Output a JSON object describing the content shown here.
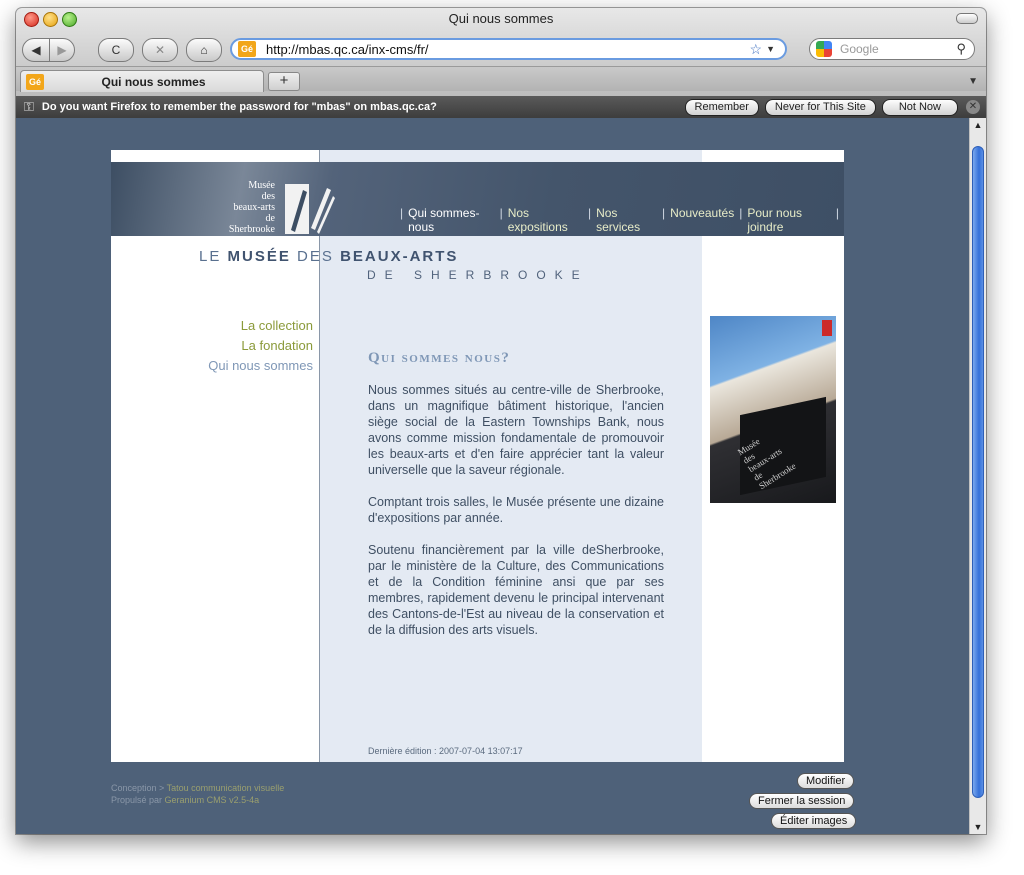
{
  "browser": {
    "window_title": "Qui nous sommes",
    "url": "http://mbas.qc.ca/inx-cms/fr/",
    "search_placeholder": "Google",
    "tab_title": "Qui nous sommes",
    "favicon_text": "Gé",
    "new_tab_label": "+",
    "nav_buttons": {
      "back": "◀",
      "forward": "▶",
      "reload": "C",
      "stop": "✕",
      "home": "⌂"
    },
    "notification": {
      "text": "Do you want Firefox to remember the password for \"mbas\" on mbas.qc.ca?",
      "remember": "Remember",
      "never": "Never for This Site",
      "not_now": "Not Now"
    }
  },
  "site": {
    "logo_lines": [
      "Musée",
      "des",
      "beaux-arts",
      "de",
      "Sherbrooke"
    ],
    "title_parts": {
      "le": "LE",
      "musee": "MUSÉE",
      "des": "DES",
      "beauxarts": "BEAUX-ARTS"
    },
    "subtitle": "DE SHERBROOKE",
    "top_nav": [
      "Qui sommes-nous",
      "Nos expositions",
      "Nos services",
      "Nouveautés",
      "Pour nous joindre"
    ],
    "side_nav": [
      "La collection",
      "La fondation",
      "Qui nous sommes"
    ],
    "heading": "Qui sommes nous?",
    "paragraphs": [
      "Nous sommes situés au centre-ville de Sherbrooke, dans un magnifique bâtiment historique, l'ancien siège social de la Eastern Townships Bank, nous avons comme mission fondamentale de promouvoir les beaux-arts et d'en faire apprécier tant la valeur universelle que la saveur régionale.",
      "Comptant trois salles, le Musée présente une dizaine d'expositions par année.",
      "Soutenu financièrement par la ville deSherbrooke, par le ministère de la Culture, des Communications et de la Condition féminine ansi que par ses membres, rapidement devenu le principal intervenant des Cantons-de-l'Est au niveau de la conservation et de la diffusion des arts visuels."
    ],
    "last_edit": "Dernière édition : 2007-07-04 13:07:17",
    "photo_sign_text": [
      "Musée",
      "des",
      "beaux-arts",
      "de",
      "Sherbrooke"
    ],
    "footer": {
      "conception_label": "Conception >",
      "conception_link": "Tatou communication visuelle",
      "powered_label": "Propulsé par",
      "powered_link": "Geranium CMS v2.5-4a"
    },
    "admin_buttons": {
      "modify": "Modifier",
      "logout": "Fermer la session",
      "edit_images": "Éditer images"
    }
  }
}
